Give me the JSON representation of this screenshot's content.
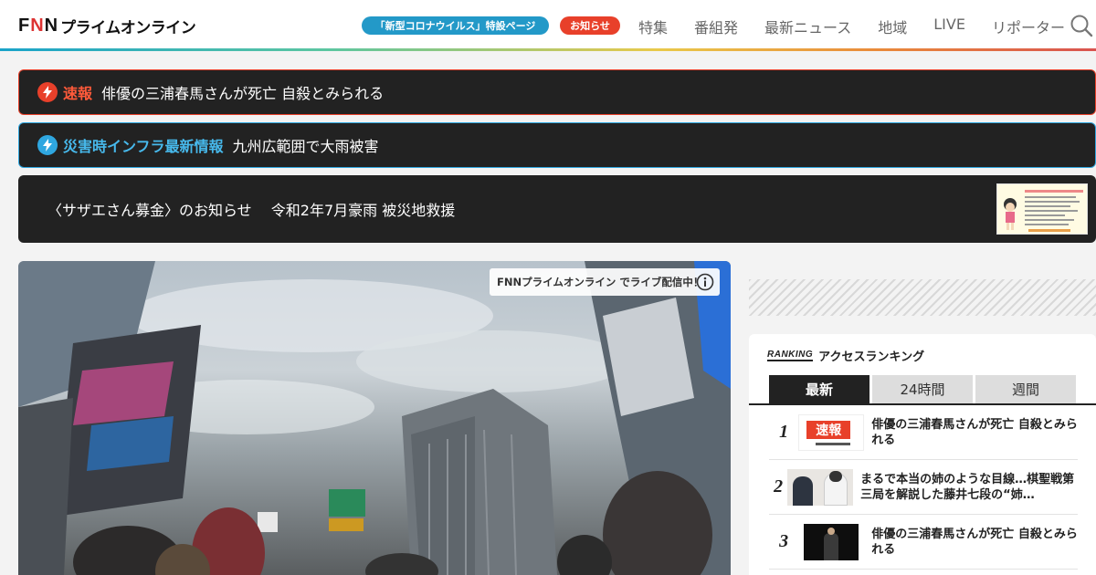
{
  "header": {
    "logo_mark": [
      "F",
      "N",
      "N"
    ],
    "logo_text": "プライムオンライン",
    "corona_pill": "「新型コロナウイルス」特設ページ",
    "notice_pill": "お知らせ",
    "nav": [
      "特集",
      "番組発",
      "最新ニュース",
      "地域",
      "LIVE",
      "リポーター"
    ]
  },
  "alerts": {
    "breaking": {
      "tag": "速報",
      "text": "俳優の三浦春馬さんが死亡 自殺とみられる"
    },
    "disaster": {
      "tag": "災害時インフラ最新情報",
      "text": "九州広範囲で大雨被害"
    }
  },
  "banner": {
    "text": "〈サザエさん募金〉のお知らせ　 令和2年7月豪雨 被災地救援"
  },
  "video": {
    "live_badge": "FNNプライムオンライン でライブ配信中！"
  },
  "ranking": {
    "label_en": "RANKING",
    "title": "アクセスランキング",
    "tabs": [
      {
        "label": "最新",
        "active": true
      },
      {
        "label": "24時間",
        "active": false
      },
      {
        "label": "週間",
        "active": false
      }
    ],
    "items": [
      {
        "rank": "1",
        "text": "俳優の三浦春馬さんが死亡 自殺とみられる",
        "thumb": "breaking"
      },
      {
        "rank": "2",
        "text": "まるで本当の姉のような目線…棋聖戦第三局を解説した藤井七段の“姉…",
        "thumb": "people"
      },
      {
        "rank": "3",
        "text": "俳優の三浦春馬さんが死亡 自殺とみられる",
        "thumb": "dark"
      }
    ],
    "thumb_breaking_label": "速報"
  },
  "colors": {
    "accent_red": "#e8402a",
    "accent_blue": "#2fa7e0",
    "corona_blue": "#2399c8"
  }
}
